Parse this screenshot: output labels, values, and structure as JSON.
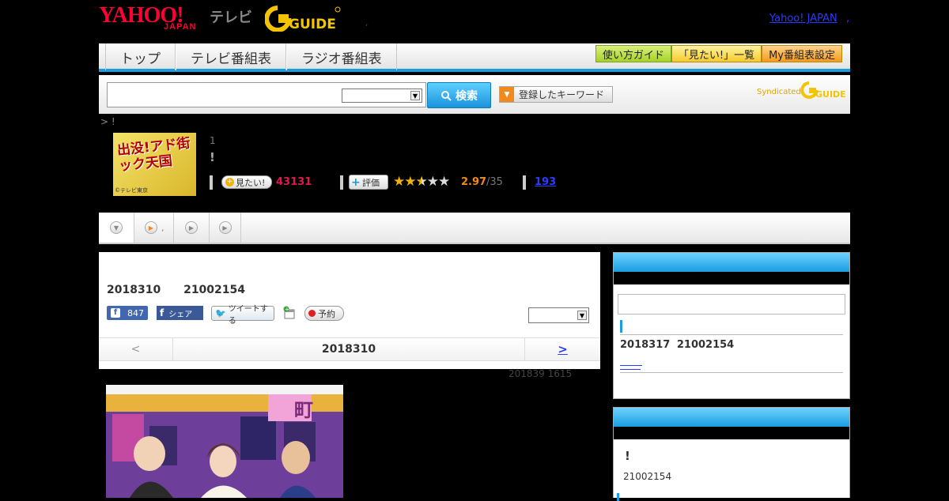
{
  "header": {
    "yahoo_logo": "YAHOO!",
    "yahoo_japan_sub": "JAPAN",
    "tv_label": "テレビ",
    "gguide_logo": "G GUIDE",
    "dot": ",",
    "yahoo_japan_link": "Yahoo! JAPAN",
    "link_sep": ","
  },
  "nav": {
    "tabs": [
      "トップ",
      "テレビ番組表",
      "ラジオ番組表"
    ],
    "buttons": [
      "使い方ガイド",
      "「見たい!」一覧",
      "My番組表設定"
    ]
  },
  "search": {
    "input_value": "",
    "select_value": "",
    "button_label": "検索",
    "keyword_button_label": "登録したキーワード",
    "syndicated_label": "Syndicated",
    "syndicated_logo": "G GUIDE"
  },
  "breadcrumb": "> !",
  "program": {
    "thumb_title": "出没!アド街ック天国",
    "thumb_copyright": "©テレビ東京",
    "episode": "1",
    "title": "!",
    "mitai_label": "見たい!",
    "mitai_count": "43131",
    "hyoka_label": "評価",
    "rating_stars": 2.5,
    "rating": "2.97",
    "rating_max": "/35",
    "comment_count": "193"
  },
  "subtabs": {
    "items": [
      {
        "icon": "chevron-down-icon",
        "label": ""
      },
      {
        "icon": "play-icon",
        "label": ","
      },
      {
        "icon": "play-icon",
        "label": ""
      },
      {
        "icon": "play-icon",
        "label": ""
      }
    ]
  },
  "main": {
    "onair_date": "2018310",
    "onair_time": "21002154",
    "fb_like_count": "847",
    "fb_share_label": "シェア",
    "tweet_label": "ツイートする",
    "yoyaku_label": "予約",
    "select_value": "",
    "prev_label": "<",
    "current_date": "2018310",
    "next_label": ">",
    "updated": "201839  1615",
    "photo_sign": "町"
  },
  "side1": {
    "next_onair_date": "2018317",
    "next_onair_time": "21002154",
    "link_text": "　　"
  },
  "side2": {
    "title": "!",
    "time": "21002154"
  },
  "colors": {
    "accent": "#1a9de0",
    "brand_red": "#ff0033",
    "mitai_pink": "#e0194d",
    "rating_orange": "#f08a1c",
    "link_blue": "#2a3bff"
  }
}
